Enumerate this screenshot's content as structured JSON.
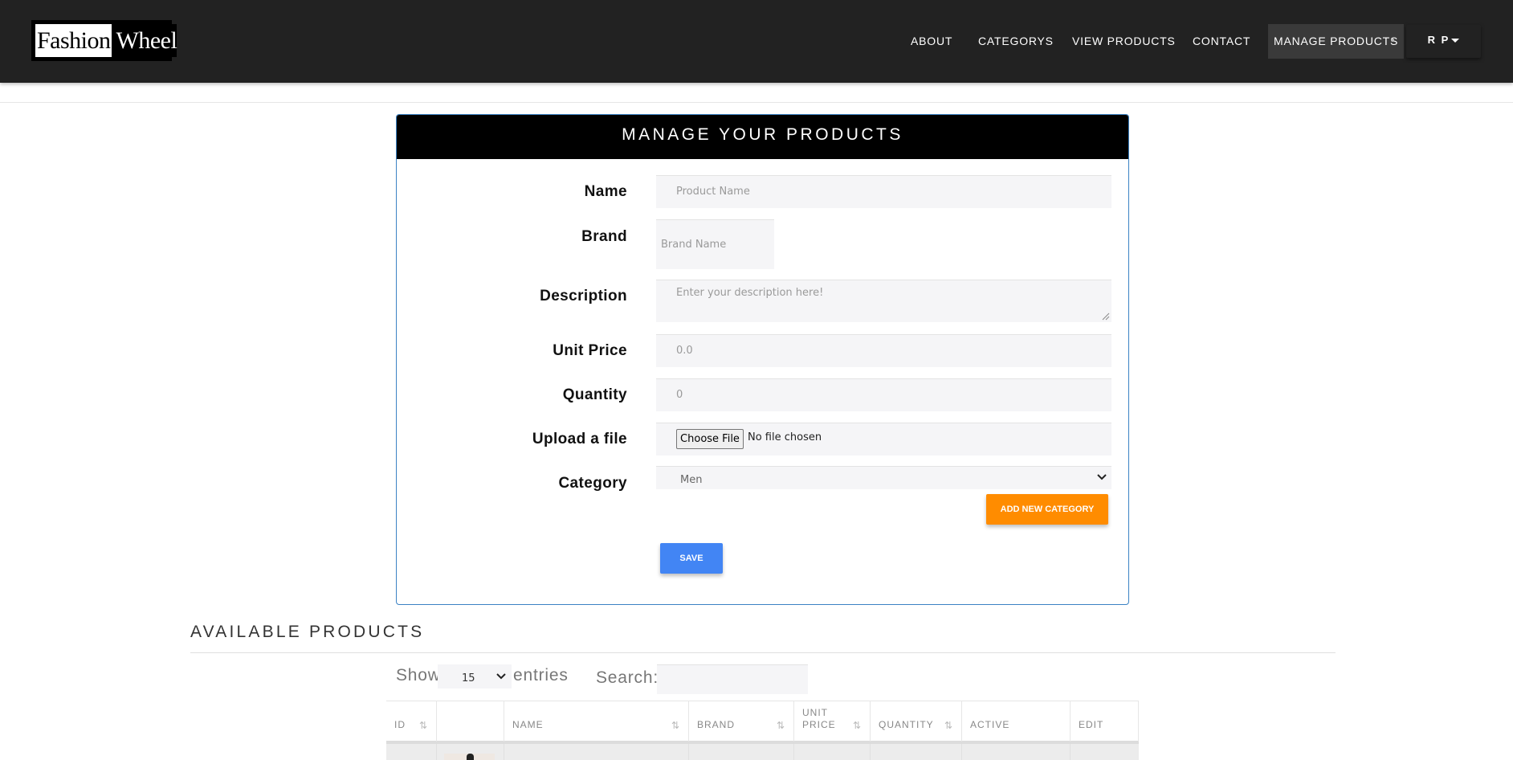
{
  "brand": {
    "logo_left": "Fashion",
    "logo_right": "Wheel"
  },
  "nav": {
    "items": [
      {
        "label": "ABOUT"
      },
      {
        "label": "CATEGORYS"
      },
      {
        "label": "VIEW PRODUCTS"
      },
      {
        "label": "CONTACT"
      },
      {
        "label": "MANAGE PRODUCTS",
        "active": true
      }
    ],
    "user_label": "R P"
  },
  "form": {
    "title": "MANAGE YOUR PRODUCTS",
    "name_label": "Name",
    "name_placeholder": "Product Name",
    "brand_label": "Brand",
    "brand_placeholder": "Brand Name",
    "description_label": "Description",
    "description_placeholder": "Enter your description here!",
    "unit_price_label": "Unit Price",
    "unit_price_value": "0.0",
    "quantity_label": "Quantity",
    "quantity_value": "0",
    "upload_label": "Upload a file",
    "choose_file_label": "Choose File",
    "no_file_text": "No file chosen",
    "category_label": "Category",
    "category_value": "Men",
    "add_category_label": "ADD NEW CATEGORY",
    "save_label": "SAVE"
  },
  "products": {
    "title": "AVAILABLE PRODUCTS",
    "show_label": "Show",
    "entries_value": "15",
    "entries_label": "entries",
    "search_label": "Search:",
    "columns": [
      "ID",
      "",
      "NAME",
      "BRAND",
      "UNIT PRICE",
      "QUANTITY",
      "ACTIVE",
      "EDIT"
    ]
  },
  "colors": {
    "accent_orange": "#ff8c00",
    "accent_blue": "#4285f4",
    "navbar": "#222222",
    "panel_border": "#3b82c4"
  },
  "icons": [
    "chevron-down-icon",
    "caret-down-icon",
    "sort-icon",
    "resize-handle-icon"
  ]
}
